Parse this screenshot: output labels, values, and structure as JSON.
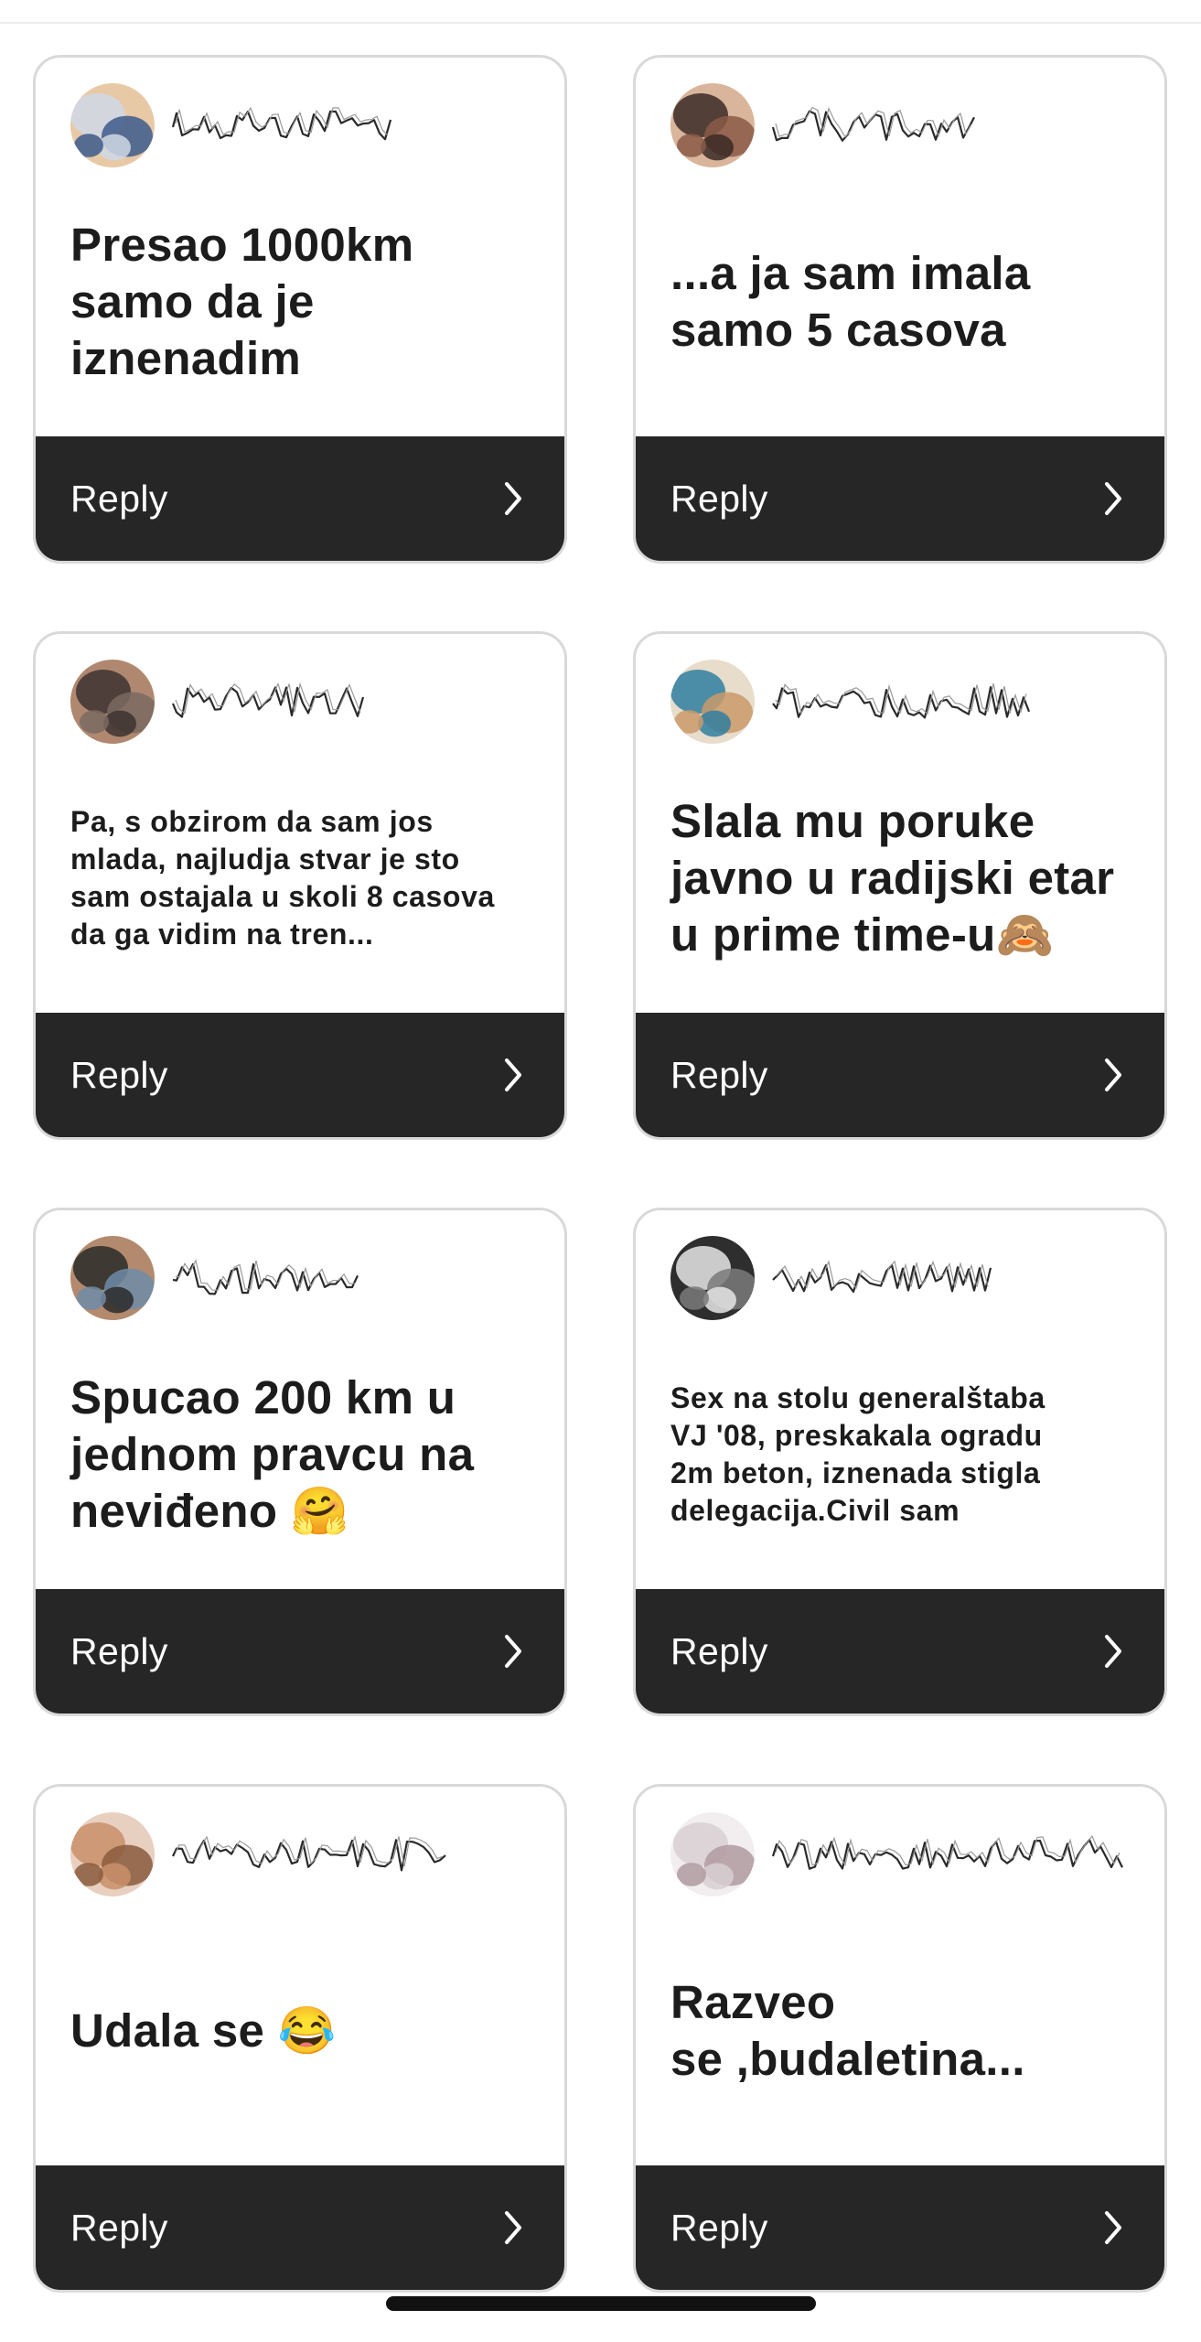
{
  "cards": [
    {
      "username_icon": "blurred-username",
      "avatar_icon": "profile-photo",
      "prompt": "Presao 1000km\nsamo da je\niznenadim",
      "size": "big",
      "reply_label": "Reply",
      "chevron_icon": "chevron-right-icon",
      "avatar_colors": [
        "#cfd8e6",
        "#3c5a8c",
        "#e8c9a6"
      ]
    },
    {
      "username_icon": "blurred-username",
      "avatar_icon": "profile-photo",
      "prompt": "...a ja sam imala\nsamo 5 casova",
      "size": "big",
      "reply_label": "Reply",
      "chevron_icon": "chevron-right-icon",
      "avatar_colors": [
        "#3a2a26",
        "#8a5a48",
        "#d9b59c"
      ]
    },
    {
      "username_icon": "blurred-username",
      "avatar_icon": "profile-photo",
      "prompt": "Pa, s obzirom da sam jos\nmlada, najludja stvar je sto\nsam ostajala u skoli 8 casova\nda ga vidim na tren...",
      "size": "small",
      "reply_label": "Reply",
      "chevron_icon": "chevron-right-icon",
      "avatar_colors": [
        "#3d3330",
        "#7a6a60",
        "#b08870"
      ]
    },
    {
      "username_icon": "blurred-username",
      "avatar_icon": "profile-photo",
      "prompt": "Slala mu poruke\njavno u radijski  etar\nu prime time-u🙈",
      "size": "big",
      "reply_label": "Reply",
      "chevron_icon": "chevron-right-icon",
      "avatar_colors": [
        "#2f7fa0",
        "#c99a6a",
        "#e8dccb"
      ]
    },
    {
      "username_icon": "blurred-username",
      "avatar_icon": "profile-photo",
      "prompt": "Spucao 200 km u\njednom pravcu na\nneviđeno 🤗",
      "size": "big",
      "reply_label": "Reply",
      "chevron_icon": "chevron-right-icon",
      "avatar_colors": [
        "#2a2a2a",
        "#6f8ca8",
        "#b48a6e"
      ]
    },
    {
      "username_icon": "blurred-username",
      "avatar_icon": "profile-photo",
      "prompt": "Sex na stolu generalštaba\nVJ '08, preskakala ogradu\n2m beton, iznenada stigla\ndelegacija.Civil sam",
      "size": "small",
      "reply_label": "Reply",
      "chevron_icon": "chevron-right-icon",
      "avatar_colors": [
        "#e6e6e6",
        "#7a7a7a",
        "#2e2e2e"
      ]
    },
    {
      "username_icon": "blurred-username",
      "avatar_icon": "profile-photo",
      "prompt": "Udala se 😂",
      "size": "big",
      "reply_label": "Reply",
      "chevron_icon": "chevron-right-icon",
      "avatar_colors": [
        "#c98f6a",
        "#8a5a3c",
        "#e8d0c0"
      ]
    },
    {
      "username_icon": "blurred-username",
      "avatar_icon": "profile-photo",
      "prompt": "Razveo\nse ,budaletina...",
      "size": "big",
      "reply_label": "Reply",
      "chevron_icon": "chevron-right-icon",
      "avatar_colors": [
        "#d8cfd2",
        "#b09aa0",
        "#f2eef0"
      ]
    }
  ]
}
